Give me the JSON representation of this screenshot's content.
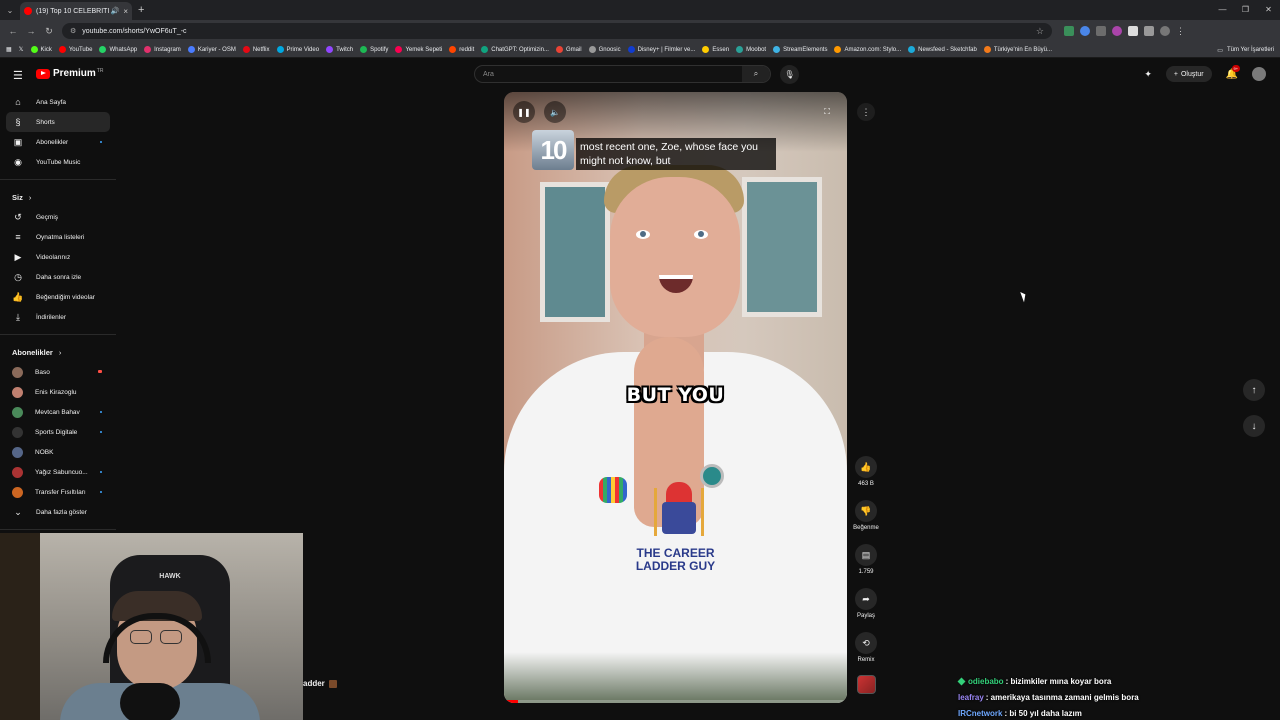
{
  "browser": {
    "tab_title": "(19) Top 10 CELEBRITIES on",
    "url": "youtube.com/shorts/YwOF6uT_-c",
    "bookmarks": [
      "Kick",
      "YouTube",
      "WhatsApp",
      "Instagram",
      "Kariyer - OSM",
      "Netflix",
      "Prime Video",
      "Twitch",
      "Spotify",
      "Yemek Sepeti",
      "reddit",
      "ChatGPT: Optimizin...",
      "Gmail",
      "Gnoosic",
      "Disney+ | Filmler ve...",
      "Essen",
      "Moobot",
      "StreamElements",
      "Amazon.com: Stylo...",
      "Newsfeed - Sketchfab",
      "Türkiye'nin En Büyü..."
    ],
    "bookmark_colors": [
      "#53fc18",
      "#ff0000",
      "#25d366",
      "#e1306c",
      "#4a7cff",
      "#e50914",
      "#00a8e1",
      "#9146ff",
      "#1db954",
      "#fa0050",
      "#ff4500",
      "#10a37f",
      "#ea4335",
      "#999999",
      "#113ccf",
      "#ffcc00",
      "#2aa198",
      "#3fb3e5",
      "#ff9900",
      "#1caad9",
      "#f27a1a"
    ],
    "all_bookmarks": "Tüm Yer İşaretleri"
  },
  "header": {
    "logo_text": "Premium",
    "logo_sup": "TR",
    "search_placeholder": "Ara",
    "create_label": "Oluştur",
    "notif_badge": "9+"
  },
  "sidebar": {
    "main": [
      {
        "label": "Ana Sayfa",
        "icon": "⌂"
      },
      {
        "label": "Shorts",
        "icon": "§"
      },
      {
        "label": "Abonelikler",
        "icon": "▣"
      },
      {
        "label": "YouTube Music",
        "icon": "◉"
      }
    ],
    "you_title": "Siz",
    "you": [
      {
        "label": "Geçmiş",
        "icon": "↺"
      },
      {
        "label": "Oynatma listeleri",
        "icon": "≡"
      },
      {
        "label": "Videolarınız",
        "icon": "▶"
      },
      {
        "label": "Daha sonra izle",
        "icon": "◷"
      },
      {
        "label": "Beğendiğim videolar",
        "icon": "👍"
      },
      {
        "label": "İndirilenler",
        "icon": "⤓"
      }
    ],
    "subs_title": "Abonelikler",
    "subs": [
      {
        "label": "Baso",
        "color": "#8a6a5a"
      },
      {
        "label": "Enis Kirazoglu",
        "color": "#c08070"
      },
      {
        "label": "Mevtcan Bahav",
        "color": "#4a8a5a"
      },
      {
        "label": "Sports Digitale",
        "color": "#333333"
      },
      {
        "label": "NOBK",
        "color": "#556688"
      },
      {
        "label": "Yağız Sabuncuo...",
        "color": "#aa3333"
      },
      {
        "label": "Transfer Fısıltıları",
        "color": "#cc6622"
      }
    ],
    "more_label": "Daha fazla göster"
  },
  "webcam": {
    "brand": "HAWK"
  },
  "overlay_text": "adder",
  "player": {
    "rank": "10",
    "subtitle": "most recent one, Zoe, whose face you might not know, but",
    "caption": "BUT YOU",
    "shirt_text_1": "THE CAREER",
    "shirt_text_2": "LADDER GUY",
    "progress": 0.04
  },
  "actions": {
    "like_count": "463 B",
    "dislike_label": "Beğenme",
    "comment_count": "1.759",
    "share_label": "Paylaş",
    "remix_label": "Remix"
  },
  "chat": [
    {
      "user": "odiebabo",
      "color": "#33d17a",
      "badge": true,
      "text": ": bizimkiler mına koyar bora"
    },
    {
      "user": "leafray",
      "color": "#9b87f5",
      "badge": false,
      "text": ": amerikaya tasınma zamani gelmis bora"
    },
    {
      "user": "IRCnetwork",
      "color": "#6fa8ff",
      "badge": false,
      "text": ": bi 50 yıl daha lazım"
    }
  ]
}
